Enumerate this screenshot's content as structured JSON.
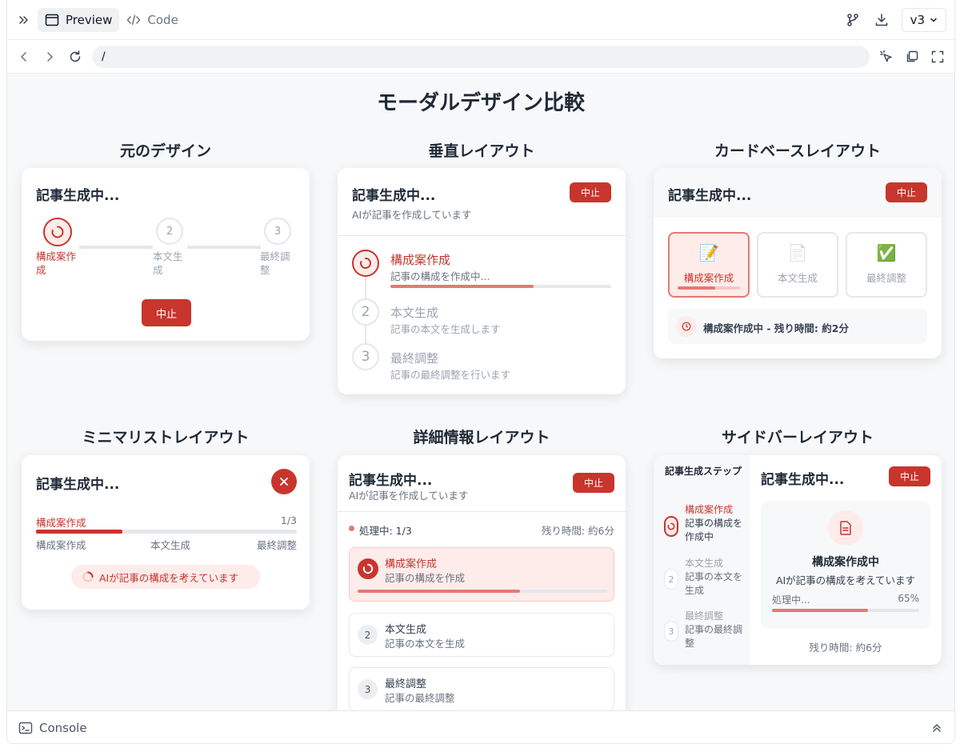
{
  "toolbar": {
    "preview_label": "Preview",
    "code_label": "Code",
    "version": "v3"
  },
  "url": "/",
  "page_title": "モーダルデザイン比較",
  "console_label": "Console",
  "colors": {
    "accent": "#c8352d",
    "accent_light": "#e37a73",
    "accent_bg": "#fdecea"
  },
  "original": {
    "section_title": "元のデザイン",
    "title": "記事生成中...",
    "steps": [
      {
        "number": "",
        "label": "構成案作成"
      },
      {
        "number": "2",
        "label": "本文生成"
      },
      {
        "number": "3",
        "label": "最終調整"
      }
    ],
    "stop_label": "中止"
  },
  "vertical": {
    "section_title": "垂直レイアウト",
    "title": "記事生成中...",
    "subtitle": "AIが記事を作成しています",
    "stop_label": "中止",
    "steps": [
      {
        "number": "",
        "label": "構成案作成",
        "desc": "記事の構成を作成中...",
        "progress": 0.65
      },
      {
        "number": "2",
        "label": "本文生成",
        "desc": "記事の本文を生成します"
      },
      {
        "number": "3",
        "label": "最終調整",
        "desc": "記事の最終調整を行います"
      }
    ]
  },
  "cardbase": {
    "section_title": "カードベースレイアウト",
    "title": "記事生成中...",
    "stop_label": "中止",
    "cards": [
      {
        "icon": "📝",
        "label": "構成案作成",
        "progress": 0.6
      },
      {
        "icon": "📄",
        "label": "本文生成"
      },
      {
        "icon": "✅",
        "label": "最終調整"
      }
    ],
    "status": "構成案作成中 - 残り時間: 約2分"
  },
  "minimal": {
    "section_title": "ミニマリストレイアウト",
    "title": "記事生成中...",
    "current": "構成案作成",
    "count": "1/3",
    "progress": 0.33,
    "labels": [
      "構成案作成",
      "本文生成",
      "最終調整"
    ],
    "status": "AIが記事の構成を考えています"
  },
  "detail": {
    "section_title": "詳細情報レイアウト",
    "title": "記事生成中...",
    "subtitle": "AIが記事を作成しています",
    "stop_label": "中止",
    "processing": "処理中: 1/3",
    "remaining": "残り時間: 約6分",
    "steps": [
      {
        "number": "",
        "label": "構成案作成",
        "desc": "記事の構成を作成",
        "progress": 0.65
      },
      {
        "number": "2",
        "label": "本文生成",
        "desc": "記事の本文を生成"
      },
      {
        "number": "3",
        "label": "最終調整",
        "desc": "記事の最終調整"
      }
    ]
  },
  "sidebar": {
    "section_title": "サイドバーレイアウト",
    "side_title": "記事生成ステップ",
    "steps": [
      {
        "number": "",
        "label": "構成案作成",
        "desc": "記事の構成を作成中"
      },
      {
        "number": "2",
        "label": "本文生成",
        "desc": "記事の本文を生成"
      },
      {
        "number": "3",
        "label": "最終調整",
        "desc": "記事の最終調整"
      }
    ],
    "title": "記事生成中...",
    "stop_label": "中止",
    "panel_title": "構成案作成中",
    "panel_desc": "AIが記事の構成を考えています",
    "processing": "処理中...",
    "percent": "65%",
    "progress": 0.65,
    "remaining": "残り時間: 約6分"
  }
}
